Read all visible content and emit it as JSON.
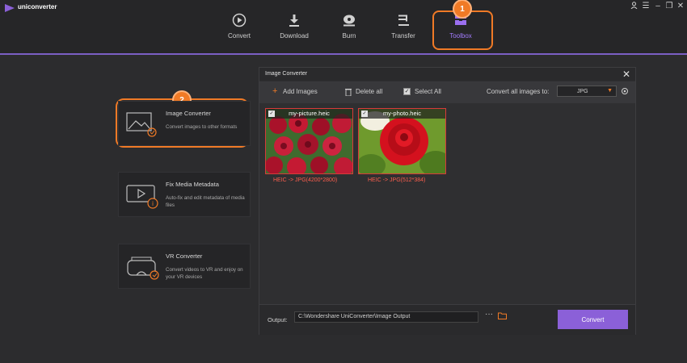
{
  "app": {
    "name": "uniconverter"
  },
  "nav": {
    "items": [
      {
        "label": "Convert",
        "icon": "convert-icon"
      },
      {
        "label": "Download",
        "icon": "download-icon"
      },
      {
        "label": "Burn",
        "icon": "burn-icon"
      },
      {
        "label": "Transfer",
        "icon": "transfer-icon"
      },
      {
        "label": "Toolbox",
        "icon": "toolbox-icon",
        "active": true
      }
    ]
  },
  "badges": [
    "1",
    "2",
    "3"
  ],
  "tools": [
    {
      "title": "Image Converter",
      "desc": "Convert images to other formats",
      "icon": "image-converter-icon"
    },
    {
      "title": "Fix Media Metadata",
      "desc": "Auto-fix and edit metadata of media files",
      "icon": "fix-metadata-icon"
    },
    {
      "title": "VR Converter",
      "desc": "Convert videos to VR and enjoy on your VR devices",
      "icon": "vr-converter-icon"
    }
  ],
  "dialog": {
    "title": "Image Converter",
    "toolbar": {
      "add_images": "Add Images",
      "delete_all": "Delete all",
      "select_all": "Select All",
      "convert_all_label": "Convert all images to:",
      "format": "JPG"
    },
    "images": [
      {
        "name": "my-picture.heic",
        "caption": "HEIC -> JPG(4200*2800)"
      },
      {
        "name": "my-photo.heic",
        "caption": "HEIC -> JPG(512*384)"
      }
    ],
    "footer": {
      "output_label": "Output:",
      "output_path": "C:\\Wondershare UniConverter\\Image Output",
      "more": "···",
      "convert_button": "Convert"
    }
  },
  "colors": {
    "accent": "#8b60d8",
    "badge": "#f07a26",
    "caption": "#ff5e4d",
    "selection": "#d83a3a"
  }
}
